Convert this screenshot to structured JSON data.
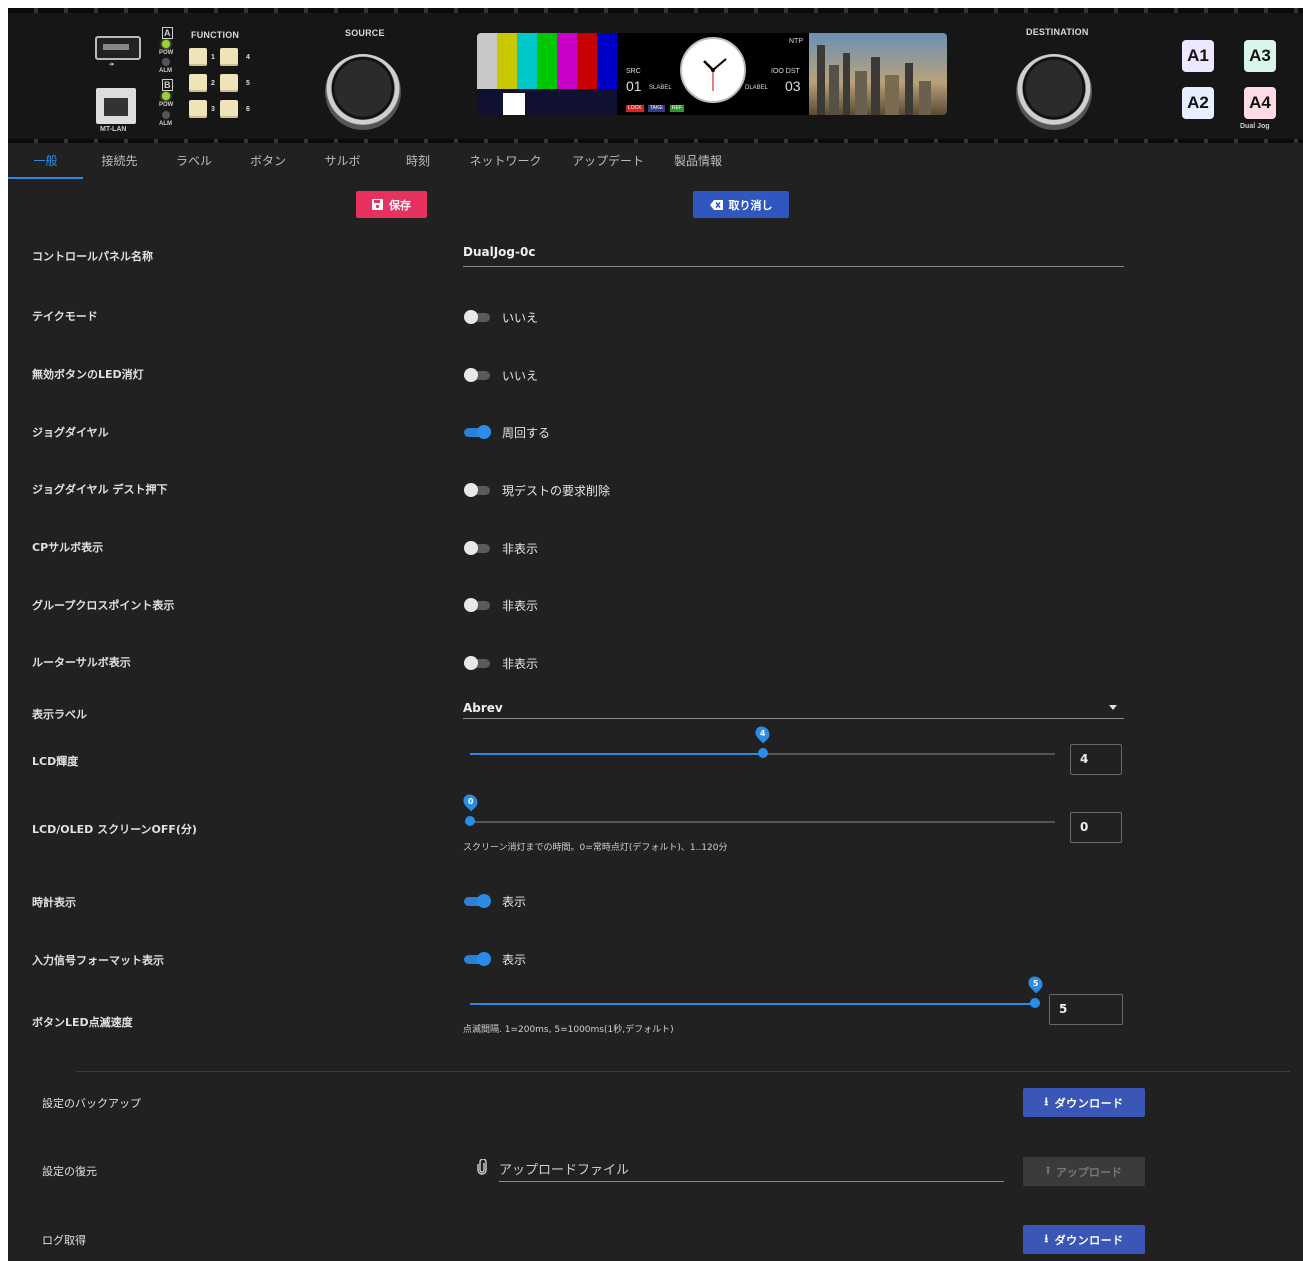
{
  "device": {
    "function_label": "FUNCTION",
    "source_label": "SOURCE",
    "destination_label": "DESTINATION",
    "mt_lan_label": "MT-LAN",
    "bank_a": "A",
    "bank_b": "B",
    "pow_label": "POW",
    "alm_label": "ALM",
    "function_keys": [
      "1",
      "2",
      "3",
      "4",
      "5",
      "6"
    ],
    "assign_keys": [
      {
        "label": "A1",
        "color": "#efe6ff"
      },
      {
        "label": "A3",
        "color": "#d9f7e8"
      },
      {
        "label": "A2",
        "color": "#e6eeff"
      },
      {
        "label": "A4",
        "color": "#ffdce4"
      }
    ],
    "model_label": "Dual Jog",
    "lcd": {
      "ntp": "NTP",
      "src": "SRC",
      "src_num": "01",
      "slabel": "SLABEL",
      "ioo_dst": "IOO DST",
      "dlabel": "DLABEL",
      "dst_num": "03",
      "lock": "LOCK",
      "take": "TAKE",
      "ref": "REF"
    }
  },
  "tabs": [
    "一般",
    "接続先",
    "ラベル",
    "ボタン",
    "サルボ",
    "時刻",
    "ネットワーク",
    "アップデート",
    "製品情報"
  ],
  "actions": {
    "save_label": "保存",
    "cancel_label": "取り消し"
  },
  "settings": {
    "panel_name": {
      "label": "コントロールパネル名称",
      "value": "DualJog-0c"
    },
    "take_mode": {
      "label": "テイクモード",
      "on": false,
      "text": "いいえ"
    },
    "led_off": {
      "label": "無効ボタンのLED消灯",
      "on": false,
      "text": "いいえ"
    },
    "jog_dial": {
      "label": "ジョグダイヤル",
      "on": true,
      "text": "周回する"
    },
    "jog_press": {
      "label": "ジョグダイヤル デスト押下",
      "on": false,
      "text": "現デストの要求削除"
    },
    "cp_salvo": {
      "label": "CPサルボ表示",
      "on": false,
      "text": "非表示"
    },
    "group_xpt": {
      "label": "グループクロスポイント表示",
      "on": false,
      "text": "非表示"
    },
    "router_salvo": {
      "label": "ルーターサルボ表示",
      "on": false,
      "text": "非表示"
    },
    "display_label": {
      "label": "表示ラベル",
      "value": "Abrev"
    },
    "lcd_brightness": {
      "label": "LCD輝度",
      "value": "4",
      "min": 0,
      "max": 8
    },
    "screen_off": {
      "label": "LCD/OLED スクリーンOFF(分)",
      "value": "0",
      "min": 0,
      "max": 120,
      "hint": "スクリーン消灯までの時間。0=常時点灯(デフォルト)、1..120分"
    },
    "clock_display": {
      "label": "時計表示",
      "on": true,
      "text": "表示"
    },
    "input_format": {
      "label": "入力信号フォーマット表示",
      "on": true,
      "text": "表示"
    },
    "blink_speed": {
      "label": "ボタンLED点滅速度",
      "value": "5",
      "min": 1,
      "max": 5,
      "hint": "点滅間隔. 1=200ms, 5=1000ms(1秒,デフォルト)"
    }
  },
  "maintenance": {
    "backup_label": "設定のバックアップ",
    "download_label": "ダウンロード",
    "restore_label": "設定の復元",
    "upload_placeholder": "アップロードファイル",
    "upload_label": "アップロード",
    "log_label": "ログ取得",
    "log_download_label": "ダウンロード"
  },
  "colors": {
    "accent": "#2a8ce6",
    "save": "#e8315f",
    "cancel": "#2f57bf",
    "background": "#212121"
  }
}
